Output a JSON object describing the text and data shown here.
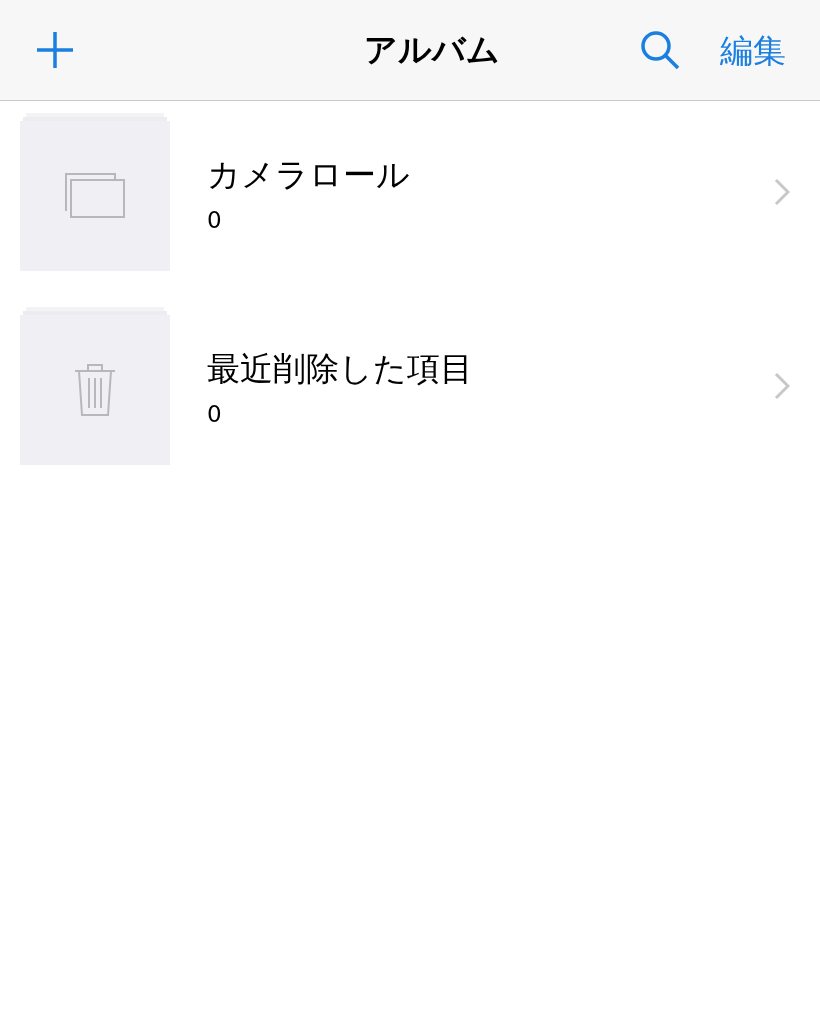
{
  "nav_bar": {
    "title": "アルバム",
    "edit_button": "編集"
  },
  "albums": [
    {
      "kind": "photos",
      "name": "カメラロール",
      "count": "0"
    },
    {
      "kind": "trash",
      "name": "最近削除した項目",
      "count": "0"
    }
  ]
}
